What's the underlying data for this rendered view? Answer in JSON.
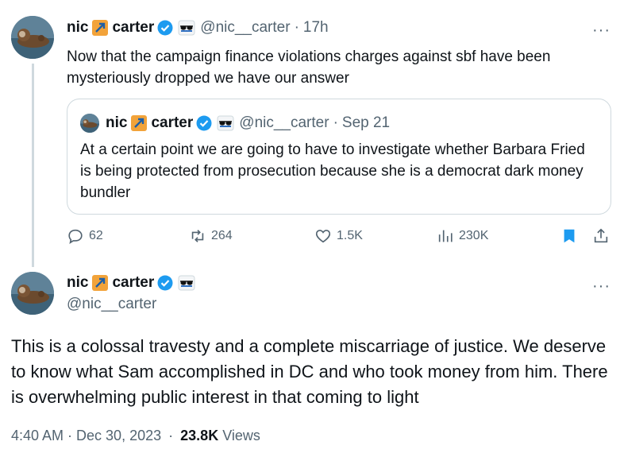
{
  "quoting_tweet": {
    "display_name_first": "nic",
    "display_name_second": "carter",
    "handle": "@nic__carter",
    "separator": "·",
    "time": "17h",
    "text": "Now that the campaign finance violations charges against sbf have been mysteriously dropped we have our answer",
    "more_label": "···"
  },
  "quoted_tweet": {
    "display_name_first": "nic",
    "display_name_second": "carter",
    "handle": "@nic__carter",
    "separator": "·",
    "time": "Sep 21",
    "text": "At a certain point we are going to have to investigate whether Barbara Fried is being protected from prosecution because she is a democrat dark money bundler"
  },
  "actions": {
    "replies": "62",
    "retweets": "264",
    "likes": "1.5K",
    "views": "230K",
    "icons": [
      "reply-icon",
      "retweet-icon",
      "like-icon",
      "views-icon",
      "bookmark-icon",
      "share-icon"
    ],
    "bookmark_color": "#1d9bf0"
  },
  "main_tweet": {
    "display_name_first": "nic",
    "display_name_second": "carter",
    "handle": "@nic__carter",
    "more_label": "···",
    "text": "This is a colossal travesty and a complete miscarriage of justice. We deserve to know what Sam accomplished in DC and who took money from him. There is overwhelming public interest in that coming to light",
    "timestamp": "4:40 AM · Dec 30, 2023",
    "separator": "·",
    "views_count": "23.8K",
    "views_label": "Views"
  },
  "colors": {
    "text": "#0f1419",
    "secondary": "#536471",
    "border": "#cfd9de",
    "verified": "#1d9bf0"
  }
}
